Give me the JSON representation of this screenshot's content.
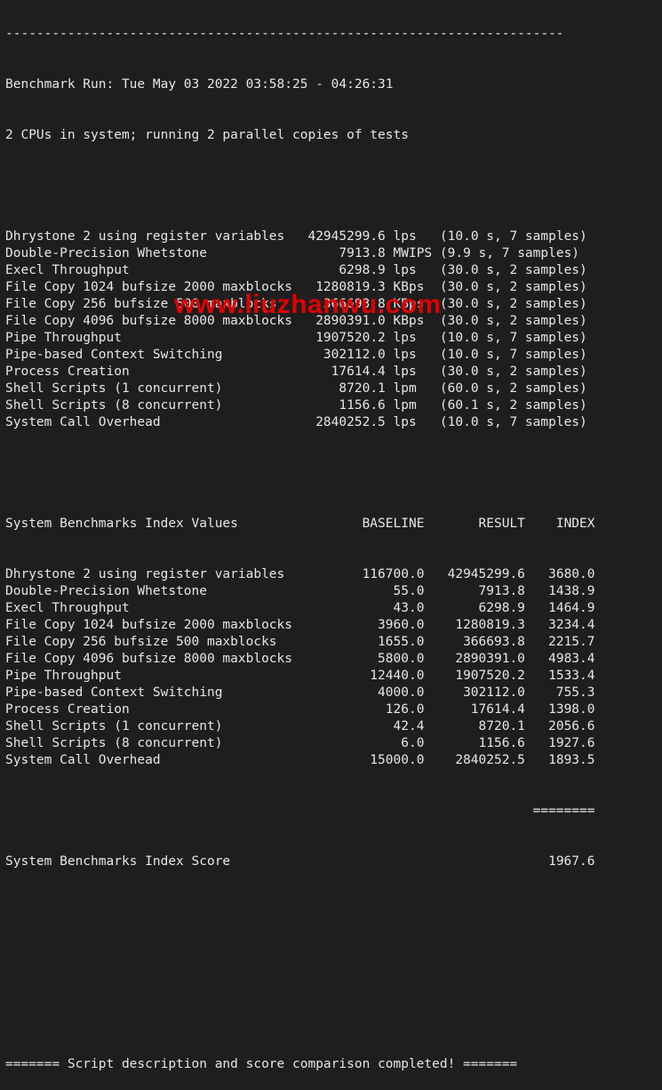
{
  "terminal": {
    "top_rule": "------------------------------------------------------------------------",
    "run_header": "Benchmark Run: Tue May 03 2022 03:58:25 - 04:26:31",
    "cpu_info": "2 CPUs in system; running 2 parallel copies of tests",
    "raw_results": [
      {
        "name": "Dhrystone 2 using register variables",
        "value": "42945299.6",
        "unit": "lps",
        "time": "10.0 s",
        "samples": "7 samples"
      },
      {
        "name": "Double-Precision Whetstone",
        "value": "7913.8",
        "unit": "MWIPS",
        "time": "9.9 s",
        "samples": "7 samples"
      },
      {
        "name": "Execl Throughput",
        "value": "6298.9",
        "unit": "lps",
        "time": "30.0 s",
        "samples": "2 samples"
      },
      {
        "name": "File Copy 1024 bufsize 2000 maxblocks",
        "value": "1280819.3",
        "unit": "KBps",
        "time": "30.0 s",
        "samples": "2 samples"
      },
      {
        "name": "File Copy 256 bufsize 500 maxblocks",
        "value": "366693.8",
        "unit": "KBps",
        "time": "30.0 s",
        "samples": "2 samples"
      },
      {
        "name": "File Copy 4096 bufsize 8000 maxblocks",
        "value": "2890391.0",
        "unit": "KBps",
        "time": "30.0 s",
        "samples": "2 samples"
      },
      {
        "name": "Pipe Throughput",
        "value": "1907520.2",
        "unit": "lps",
        "time": "10.0 s",
        "samples": "7 samples"
      },
      {
        "name": "Pipe-based Context Switching",
        "value": "302112.0",
        "unit": "lps",
        "time": "10.0 s",
        "samples": "7 samples"
      },
      {
        "name": "Process Creation",
        "value": "17614.4",
        "unit": "lps",
        "time": "30.0 s",
        "samples": "2 samples"
      },
      {
        "name": "Shell Scripts (1 concurrent)",
        "value": "8720.1",
        "unit": "lpm",
        "time": "60.0 s",
        "samples": "2 samples"
      },
      {
        "name": "Shell Scripts (8 concurrent)",
        "value": "1156.6",
        "unit": "lpm",
        "time": "60.1 s",
        "samples": "2 samples"
      },
      {
        "name": "System Call Overhead",
        "value": "2840252.5",
        "unit": "lps",
        "time": "10.0 s",
        "samples": "7 samples"
      }
    ],
    "index_header": {
      "title": "System Benchmarks Index Values",
      "baseline": "BASELINE",
      "result": "RESULT",
      "index": "INDEX"
    },
    "index_values": [
      {
        "name": "Dhrystone 2 using register variables",
        "baseline": "116700.0",
        "result": "42945299.6",
        "index": "3680.0"
      },
      {
        "name": "Double-Precision Whetstone",
        "baseline": "55.0",
        "result": "7913.8",
        "index": "1438.9"
      },
      {
        "name": "Execl Throughput",
        "baseline": "43.0",
        "result": "6298.9",
        "index": "1464.9"
      },
      {
        "name": "File Copy 1024 bufsize 2000 maxblocks",
        "baseline": "3960.0",
        "result": "1280819.3",
        "index": "3234.4"
      },
      {
        "name": "File Copy 256 bufsize 500 maxblocks",
        "baseline": "1655.0",
        "result": "366693.8",
        "index": "2215.7"
      },
      {
        "name": "File Copy 4096 bufsize 8000 maxblocks",
        "baseline": "5800.0",
        "result": "2890391.0",
        "index": "4983.4"
      },
      {
        "name": "Pipe Throughput",
        "baseline": "12440.0",
        "result": "1907520.2",
        "index": "1533.4"
      },
      {
        "name": "Pipe-based Context Switching",
        "baseline": "4000.0",
        "result": "302112.0",
        "index": "755.3"
      },
      {
        "name": "Process Creation",
        "baseline": "126.0",
        "result": "17614.4",
        "index": "1398.0"
      },
      {
        "name": "Shell Scripts (1 concurrent)",
        "baseline": "42.4",
        "result": "8720.1",
        "index": "2056.6"
      },
      {
        "name": "Shell Scripts (8 concurrent)",
        "baseline": "6.0",
        "result": "1156.6",
        "index": "1927.6"
      },
      {
        "name": "System Call Overhead",
        "baseline": "15000.0",
        "result": "2840252.5",
        "index": "1893.5"
      }
    ],
    "score_rule": "========",
    "score_label": "System Benchmarks Index Score",
    "score_value": "1967.6",
    "footer": "======= Script description and score comparison completed! ======="
  },
  "watermark": {
    "text": "www.liuzhanwu.com",
    "color": "#e00000"
  }
}
